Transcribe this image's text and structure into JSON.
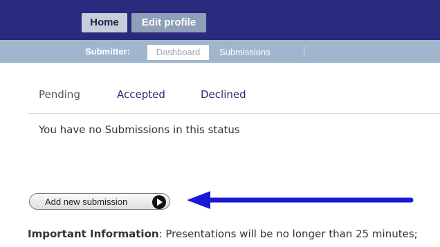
{
  "topnav": {
    "home": "Home",
    "edit_profile": "Edit profile"
  },
  "subnav": {
    "label": "Submitter:",
    "dashboard": "Dashboard",
    "submissions": "Submissions"
  },
  "tabs": [
    "Pending",
    "Accepted",
    "Declined"
  ],
  "empty_message": "You have no Submissions in this status",
  "add_button": {
    "label": "Add new submission",
    "icon": "plus-circle-icon"
  },
  "annotation": {
    "icon": "arrow-left-icon",
    "color": "#1a1ad6"
  },
  "important": {
    "label": "Important Information",
    "text": ": Presentations will be no longer than 25 minutes;"
  },
  "colors": {
    "topbar": "#2a2a7e",
    "subbar": "#9fb6cc",
    "link": "#2b2b6e"
  }
}
